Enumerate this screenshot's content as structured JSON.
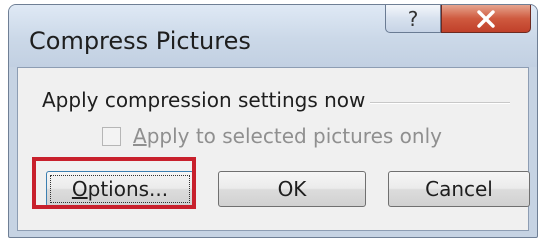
{
  "dialog": {
    "title": "Compress Pictures",
    "help_button": "?",
    "close_button_icon": "close-icon"
  },
  "group": {
    "label": "Apply compression settings now"
  },
  "checkbox": {
    "label_underlined": "A",
    "label_rest": "pply to selected pictures only",
    "checked": false,
    "enabled": false
  },
  "buttons": {
    "options_underlined": "O",
    "options_rest": "ptions...",
    "ok": "OK",
    "cancel": "Cancel"
  },
  "annotation": {
    "highlight_color": "#c8202c",
    "highlight_target": "options-button"
  },
  "colors": {
    "close_button": "#c9503a",
    "frame": "#c6d3e3",
    "content_bg": "#f0f0f0"
  }
}
